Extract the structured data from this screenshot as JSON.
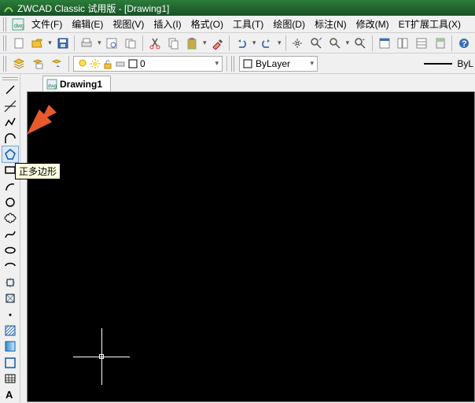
{
  "title": "ZWCAD Classic 试用版 - [Drawing1]",
  "menu": {
    "file": "文件(F)",
    "edit": "编辑(E)",
    "view": "视图(V)",
    "insert": "插入(I)",
    "format": "格式(O)",
    "tools": "工具(T)",
    "draw": "绘图(D)",
    "annotate": "标注(N)",
    "modify": "修改(M)",
    "et": "ET扩展工具(X)"
  },
  "row2": {
    "layer_value": "0",
    "bylayer": "ByLayer",
    "right_text": "ByL"
  },
  "doc_tab": "Drawing1",
  "tooltip": "正多边形",
  "colors": {
    "accent": "#e85a2a"
  }
}
